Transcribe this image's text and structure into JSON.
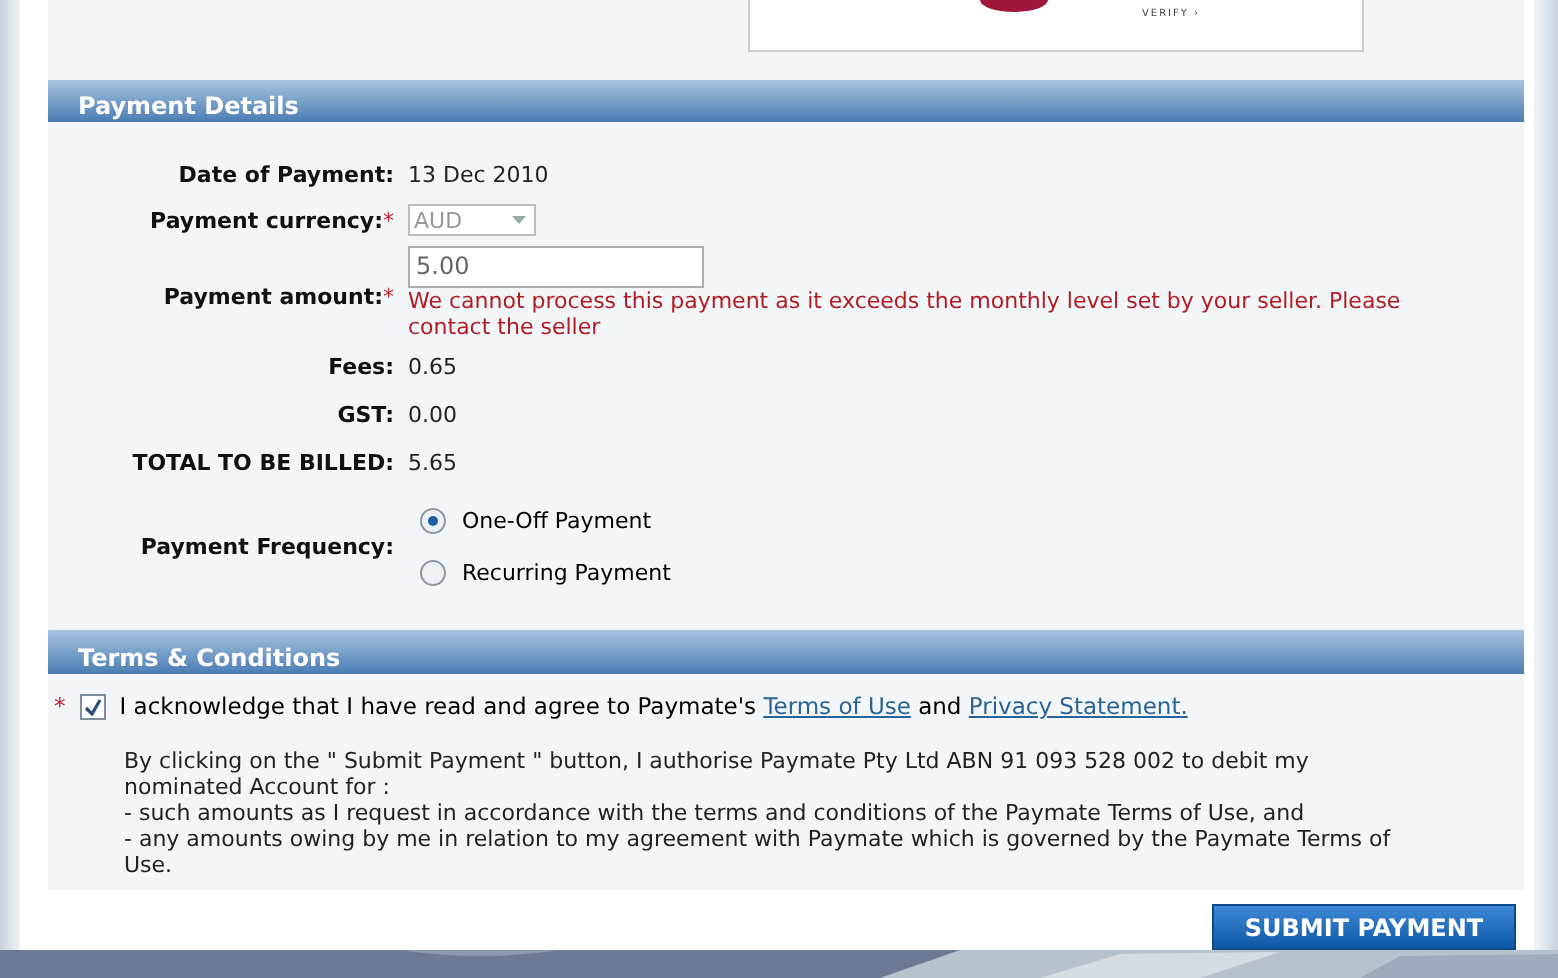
{
  "logo": {
    "tagline": "VERIFY ›"
  },
  "payment_details": {
    "title": "Payment Details",
    "fields": [
      {
        "kind": "text",
        "label": "Date of Payment:",
        "value": "13 Dec 2010"
      },
      {
        "kind": "select",
        "label": "Payment currency:",
        "required_mark": "*",
        "value": "AUD",
        "disabled": true
      },
      {
        "kind": "input",
        "label": "Payment amount:",
        "required_mark": "*",
        "value": "5.00",
        "error": "We cannot process this payment as it exceeds the monthly level set by your seller. Please contact the seller"
      },
      {
        "kind": "text",
        "label": "Fees:",
        "value": "0.65"
      },
      {
        "kind": "text",
        "label": "GST:",
        "value": "0.00"
      },
      {
        "kind": "text",
        "label": "TOTAL TO BE BILLED:",
        "value": "5.65"
      },
      {
        "kind": "radio",
        "label": "Payment Frequency:",
        "options": [
          {
            "label": "One-Off Payment",
            "selected": true
          },
          {
            "label": "Recurring Payment",
            "selected": false
          }
        ]
      }
    ]
  },
  "terms": {
    "title": "Terms & Conditions",
    "required_mark": "*",
    "acknowledge": {
      "checked": true,
      "text": "I acknowledge that I have read and agree to Paymate's",
      "link_terms": "Terms of Use",
      "joiner": "and",
      "link_privacy": "Privacy Statement."
    },
    "authorisation": [
      "By clicking on the \" Submit Payment \" button, I authorise Paymate Pty Ltd ABN 91 093 528 002 to debit my nominated Account for :",
      "- such amounts as I request in accordance with the terms and conditions of the Paymate Terms of Use, and",
      "- any amounts owing by me in relation to my agreement with Paymate which is governed by the Paymate Terms of Use."
    ]
  },
  "submit_button": "SUBMIT PAYMENT"
}
